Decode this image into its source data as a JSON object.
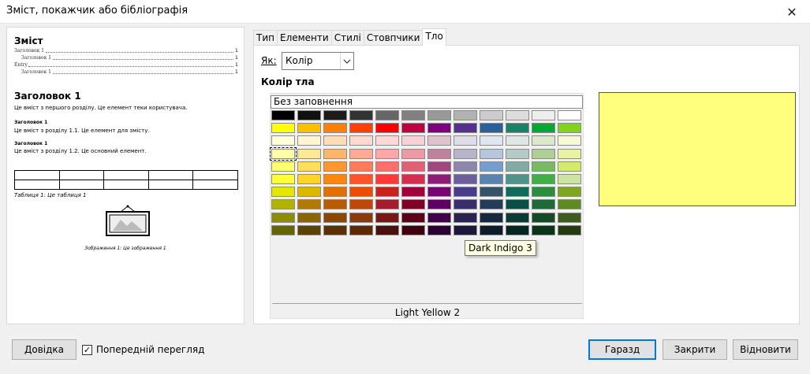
{
  "window": {
    "title": "Зміст, покажчик або бібліографія",
    "close_icon": "close-icon"
  },
  "preview": {
    "toc_title": "Зміст",
    "toc_entries": [
      {
        "text": "Заголовок 1",
        "page": "1"
      },
      {
        "text": "Заголовок 1",
        "page": "1"
      },
      {
        "text": "Entry",
        "page": "1"
      },
      {
        "text": "Заголовок 1",
        "page": "1"
      }
    ],
    "heading1": "Заголовок 1",
    "paragraph1": "Це вміст з першого розділу. Це елемент теки користувача.",
    "heading1_1": "Заголовок 1",
    "paragraph1_1": "Це вміст з розділу 1.1. Це елемент для змісту.",
    "heading1_2": "Заголовок 1",
    "paragraph1_2": "Це вміст з розділу 1.2. Це основний елемент.",
    "table_caption": "Таблиця 1: Це таблиця 1",
    "image_caption": "Зображення 1: Це зображення 1"
  },
  "tabs": [
    {
      "label": "Тип"
    },
    {
      "label": "Елементи"
    },
    {
      "label": "Стилі"
    },
    {
      "label": "Стовпчики"
    },
    {
      "label": "Тло",
      "active": true
    }
  ],
  "background": {
    "as_label": "Як:",
    "as_value": "Колір",
    "section_title": "Колір тла",
    "no_fill_label": "Без заповнення",
    "selected_palette_name": "Light Yellow 2",
    "tooltip": "Dark Indigo 3",
    "preview_color": "#ffff7d"
  },
  "palette": {
    "rows": [
      [
        "#000000",
        "#111111",
        "#1c1c1c",
        "#333333",
        "#666666",
        "#808080",
        "#999999",
        "#b2b2b2",
        "#cccccc",
        "#dddddd",
        "#eeeeee",
        "#ffffff"
      ],
      [
        "#ffff00",
        "#ffbf00",
        "#ff8000",
        "#ff4000",
        "#ff0000",
        "#bf0041",
        "#800080",
        "#55308d",
        "#2a6099",
        "#158466",
        "#00a933",
        "#81d41a"
      ],
      [
        "#ffffd7",
        "#fff5ce",
        "#ffdbb6",
        "#ffd8ce",
        "#ffd7d7",
        "#f7d1d5",
        "#e0c2cd",
        "#dedce6",
        "#dee6ef",
        "#dee7e5",
        "#dde8cb",
        "#f6f9d4"
      ],
      [
        "#ffffa6",
        "#ffe994",
        "#ffb66c",
        "#ffaa95",
        "#ffa6a6",
        "#ec9ba4",
        "#bf819e",
        "#b7b3ca",
        "#b4c7dc",
        "#b3cac7",
        "#afd095",
        "#e8f2a1"
      ],
      [
        "#ffff6d",
        "#ffde59",
        "#ff972f",
        "#ff7b59",
        "#ff6d6d",
        "#e16173",
        "#a1467e",
        "#8e86ae",
        "#729fcf",
        "#81aca6",
        "#77bc65",
        "#d4ea6b"
      ],
      [
        "#ffff38",
        "#ffd428",
        "#ff860d",
        "#ff5429",
        "#ff3838",
        "#d62e4e",
        "#8d1d75",
        "#6b5e9b",
        "#5983b0",
        "#50938a",
        "#3faf46",
        "#c9e4a3"
      ],
      [
        "#e6e600",
        "#dcb900",
        "#e17000",
        "#ed4c05",
        "#c9211e",
        "#a1003c",
        "#780373",
        "#483d8b",
        "#355269",
        "#116b5c",
        "#2a8e3c",
        "#7fa623"
      ],
      [
        "#b2b200",
        "#b47804",
        "#b85c00",
        "#be480a",
        "#a51d2d",
        "#800026",
        "#5f0064",
        "#3a2f6b",
        "#233c5a",
        "#0a4f46",
        "#1e6a39",
        "#5e8a24"
      ],
      [
        "#8d8d00",
        "#8c6400",
        "#8c4600",
        "#8d3a0a",
        "#7b1616",
        "#5e001a",
        "#43004a",
        "#2a2252",
        "#162840",
        "#073b34",
        "#154a28",
        "#3d5c1d"
      ],
      [
        "#666600",
        "#5c4400",
        "#5c3000",
        "#5e2900",
        "#4c0f0f",
        "#3f0010",
        "#2c0032",
        "#1d1739",
        "#0d1b2a",
        "#032620",
        "#0c321a",
        "#263a12"
      ]
    ],
    "selected_color": "#ffffa6"
  },
  "footer": {
    "help_label": "Довідка",
    "preview_checkbox_label": "Попередній перегляд",
    "preview_checked": true,
    "ok_label": "Гаразд",
    "close_label": "Закрити",
    "reset_label": "Відновити"
  }
}
